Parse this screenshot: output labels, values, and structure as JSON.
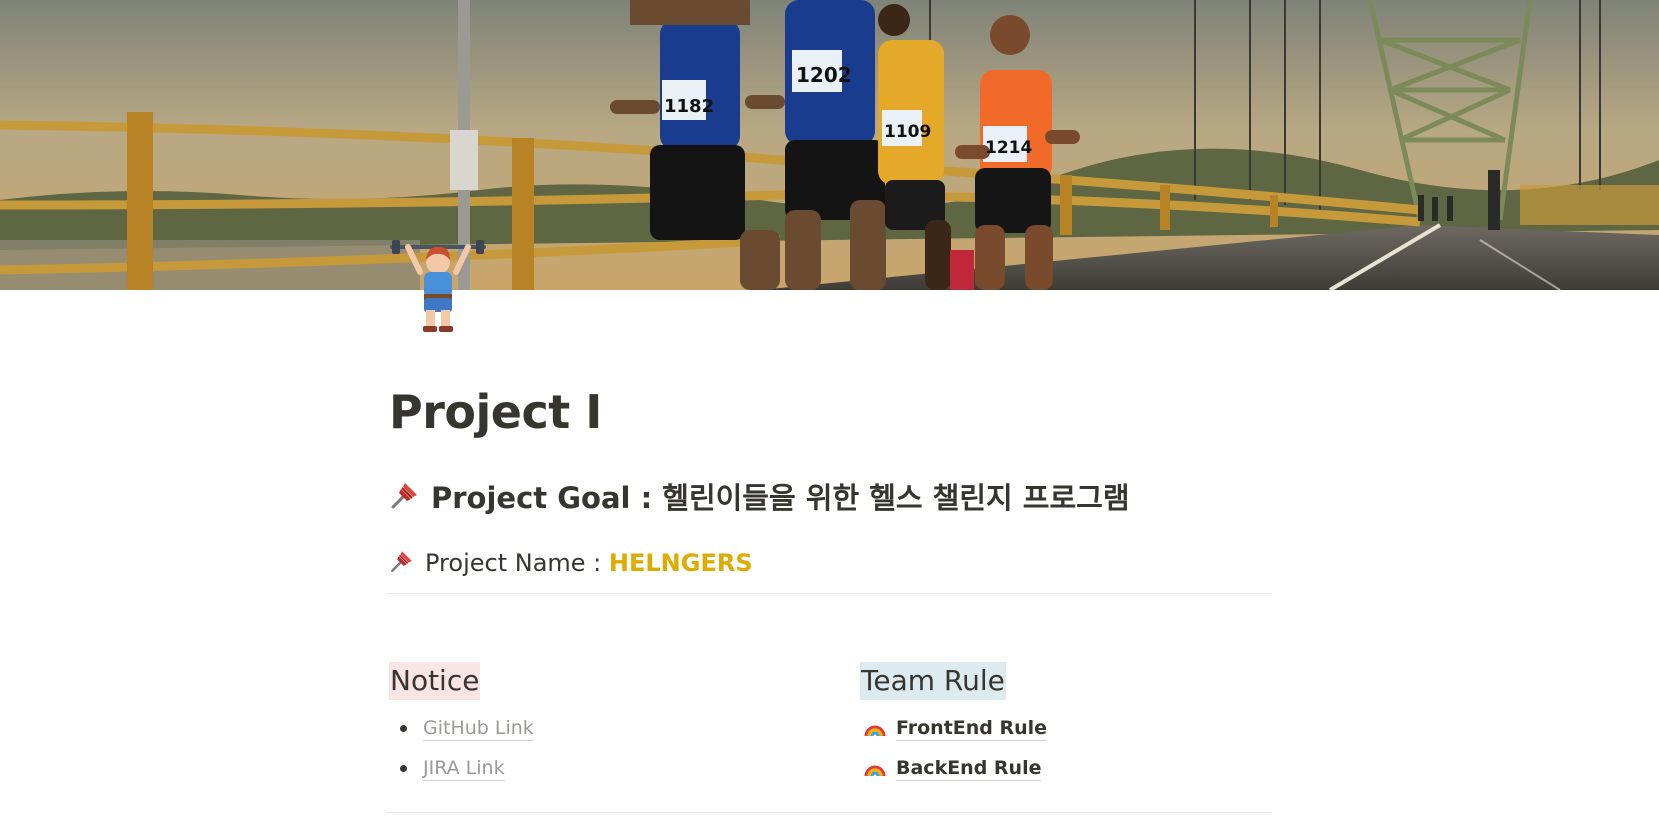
{
  "cover": {
    "icon": "marathon-runners-on-bridge-photo"
  },
  "page_icon": "weight-lifter-icon",
  "title": "Project Ⅰ",
  "goal": {
    "icon": "pushpin-icon",
    "text": "Project Goal : 헬린이들을 위한 헬스 챌린지 프로그램"
  },
  "name": {
    "icon": "pushpin-icon",
    "label": "Project Name : ",
    "value": "HELNGERS",
    "value_color": "#dfab01"
  },
  "notice": {
    "heading": "Notice",
    "heading_bg": "#fbe4e4",
    "links": [
      {
        "label": "GitHub Link"
      },
      {
        "label": "JIRA Link"
      }
    ]
  },
  "team_rule": {
    "heading": "Team Rule",
    "heading_bg": "#ddebf1",
    "links": [
      {
        "icon": "rainbow-icon",
        "label": "FrontEnd Rule"
      },
      {
        "icon": "rainbow-icon",
        "label": "BackEnd Rule"
      }
    ]
  }
}
